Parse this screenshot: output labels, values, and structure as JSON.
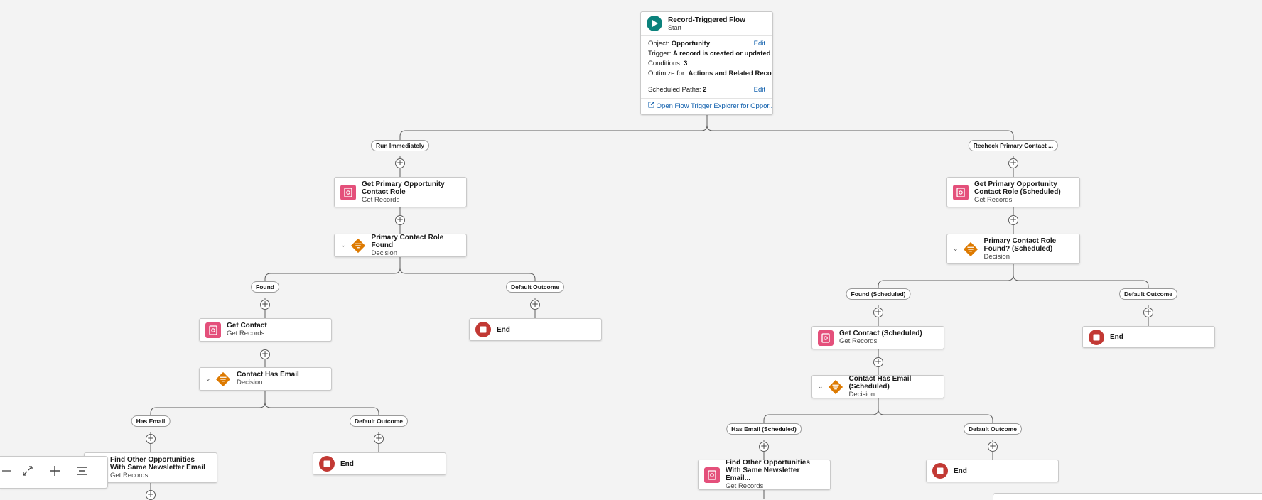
{
  "start": {
    "title": "Record-Triggered Flow",
    "subtitle": "Start",
    "object_label": "Object:",
    "object_value": "Opportunity",
    "trigger_label": "Trigger:",
    "trigger_value": "A record is created or updated",
    "conditions_label": "Conditions:",
    "conditions_value": "3",
    "optimize_label": "Optimize for:",
    "optimize_value": "Actions and Related Recor...",
    "scheduled_label": "Scheduled Paths:",
    "scheduled_value": "2",
    "edit": "Edit",
    "explorer_link": "Open Flow Trigger Explorer for Oppor..."
  },
  "paths": {
    "run_immediately": "Run Immediately",
    "recheck": "Recheck Primary Contact ..."
  },
  "left": {
    "get_role_title": "Get Primary Opportunity Contact Role",
    "get_role_sub": "Get Records",
    "decision_title": "Primary Contact Role Found",
    "decision_sub": "Decision",
    "found": "Found",
    "default": "Default Outcome",
    "end1": "End",
    "get_contact_title": "Get Contact",
    "get_contact_sub": "Get Records",
    "has_email_dec_title": "Contact Has Email",
    "has_email_dec_sub": "Decision",
    "has_email": "Has Email",
    "default2": "Default Outcome",
    "end2": "End",
    "find_title": "Find Other Opportunities With Same Newsletter Email",
    "find_sub": "Get Records"
  },
  "right": {
    "get_role_title": "Get Primary Opportunity Contact Role (Scheduled)",
    "get_role_sub": "Get Records",
    "decision_title": "Primary Contact Role Found? (Scheduled)",
    "decision_sub": "Decision",
    "found": "Found (Scheduled)",
    "default": "Default Outcome",
    "end1": "End",
    "get_contact_title": "Get Contact (Scheduled)",
    "get_contact_sub": "Get Records",
    "has_email_dec_title": "Contact Has Email (Scheduled)",
    "has_email_dec_sub": "Decision",
    "has_email": "Has Email (Scheduled)",
    "default2": "Default Outcome",
    "end2": "End",
    "find_title": "Find Other Opportunities With Same Newsletter Email...",
    "find_sub": "Get Records"
  },
  "colors": {
    "start_icon": "#0b827c",
    "get_records_icon": "#e4507b",
    "decision_icon": "#dd7a01",
    "end_icon": "#c23934"
  },
  "icons": {
    "start": "play-icon",
    "get_records": "get-records-icon",
    "decision": "decision-icon",
    "end": "stop-icon",
    "zoom_out": "minus-icon",
    "fit": "expand-icon",
    "zoom_in": "plus-icon",
    "auto_layout": "align-icon"
  }
}
